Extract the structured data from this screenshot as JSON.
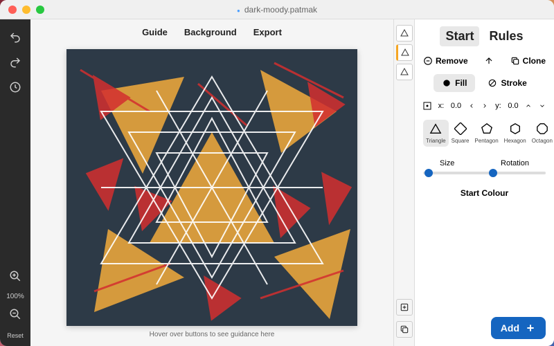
{
  "window": {
    "title": "dark-moody.patmak"
  },
  "top_menu": {
    "guide": "Guide",
    "background": "Background",
    "export": "Export"
  },
  "left": {
    "zoom": "100%",
    "reset": "Reset"
  },
  "hint": "Hover over buttons to see guidance here",
  "tabs": {
    "start": "Start",
    "rules": "Rules"
  },
  "actions": {
    "remove": "Remove",
    "clone": "Clone"
  },
  "fillstroke": {
    "fill": "Fill",
    "stroke": "Stroke"
  },
  "coords": {
    "xlabel": "x:",
    "xval": "0.0",
    "ylabel": "y:",
    "yval": "0.0"
  },
  "shapes": {
    "triangle": "Triangle",
    "square": "Square",
    "pentagon": "Pentagon",
    "hexagon": "Hexagon",
    "octagon": "Octagon"
  },
  "sliders": {
    "size": "Size",
    "rotation": "Rotation"
  },
  "colour": "Start Colour",
  "add": "Add"
}
